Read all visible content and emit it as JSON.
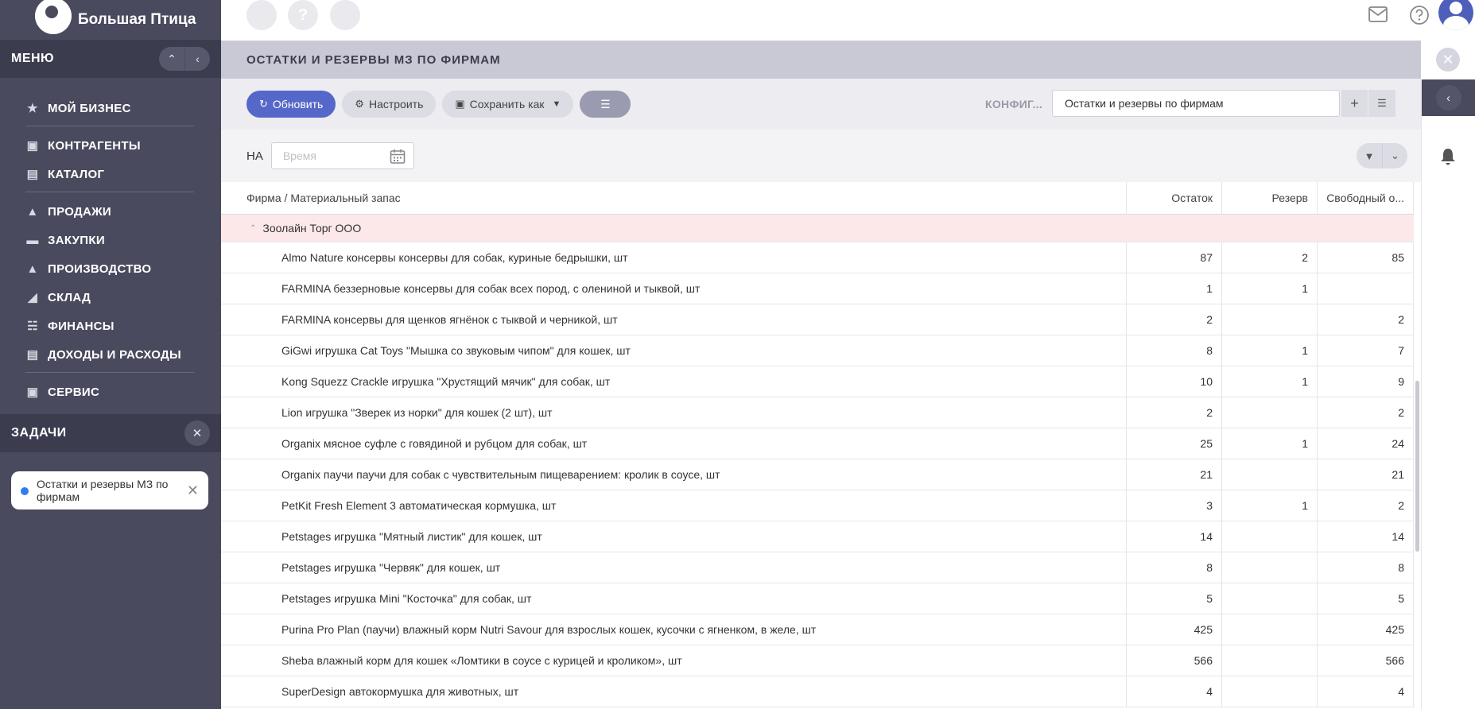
{
  "app": {
    "logo_text": "Большая Птица"
  },
  "sidebar": {
    "menu_title": "МЕНЮ",
    "groups": [
      [
        {
          "label": "МОЙ БИЗНЕС",
          "icon": "star-icon"
        }
      ],
      [
        {
          "label": "КОНТРАГЕНТЫ",
          "icon": "briefcase-icon"
        },
        {
          "label": "КАТАЛОГ",
          "icon": "book-icon"
        }
      ],
      [
        {
          "label": "ПРОДАЖИ",
          "icon": "basket-icon"
        },
        {
          "label": "ЗАКУПКИ",
          "icon": "truck-icon"
        },
        {
          "label": "ПРОИЗВОДСТВО",
          "icon": "factory-icon"
        },
        {
          "label": "СКЛАД",
          "icon": "warehouse-icon"
        },
        {
          "label": "ФИНАНСЫ",
          "icon": "bank-icon"
        },
        {
          "label": "ДОХОДЫ И РАСХОДЫ",
          "icon": "wallet-icon"
        }
      ],
      [
        {
          "label": "СЕРВИС",
          "icon": "service-icon"
        }
      ]
    ],
    "tasks_title": "ЗАДАЧИ",
    "task_card": "Остатки и резервы МЗ по фирмам"
  },
  "main": {
    "title": "ОСТАТКИ И РЕЗЕРВЫ МЗ ПО ФИРМАМ",
    "toolbar": {
      "refresh": "Обновить",
      "configure": "Настроить",
      "save_as": "Сохранить как",
      "config_label": "КОНФИГ...",
      "config_value": "Остатки и резервы по фирмам"
    },
    "filter": {
      "on_label": "НА",
      "date_placeholder": "Время"
    },
    "table": {
      "columns": [
        "Фирма / Материальный запас",
        "Остаток",
        "Резерв",
        "Свободный о..."
      ],
      "group": "Зоолайн Торг ООО",
      "rows": [
        [
          "Almo Nature консервы консервы для собак, куриные бедрышки, шт",
          "87",
          "2",
          "85"
        ],
        [
          "FARMINA беззерновые консервы для собак всех пород, с олениной и тыквой, шт",
          "1",
          "1",
          ""
        ],
        [
          "FARMINA консервы для щенков ягнёнок с тыквой и черникой, шт",
          "2",
          "",
          "2"
        ],
        [
          "GiGwi игрушка Cat Toys \"Мышка со звуковым чипом\" для кошек, шт",
          "8",
          "1",
          "7"
        ],
        [
          "Kong Squezz Crackle игрушка \"Хрустящий мячик\" для собак, шт",
          "10",
          "1",
          "9"
        ],
        [
          "Lion игрушка \"Зверек из норки\" для кошек (2 шт), шт",
          "2",
          "",
          "2"
        ],
        [
          "Organix мясное суфле с говядиной и рубцом для собак, шт",
          "25",
          "1",
          "24"
        ],
        [
          "Organix паучи паучи для собак с чувствительным пищеварением: кролик в соусе, шт",
          "21",
          "",
          "21"
        ],
        [
          "PetKit Fresh Element 3 автоматическая кормушка, шт",
          "3",
          "1",
          "2"
        ],
        [
          "Petstages игрушка \"Мятный листик\" для кошек, шт",
          "14",
          "",
          "14"
        ],
        [
          "Petstages игрушка \"Червяк\" для кошек, шт",
          "8",
          "",
          "8"
        ],
        [
          "Petstages игрушка Mini \"Косточка\" для собак, шт",
          "5",
          "",
          "5"
        ],
        [
          "Purina Pro Plan (паучи) влажный корм Nutri Savour для взрослых кошек, кусочки с ягненком, в желе, шт",
          "425",
          "",
          "425"
        ],
        [
          "Sheba влажный корм для кошек «Ломтики в соусе с курицей и кроликом», шт",
          "566",
          "",
          "566"
        ],
        [
          "SuperDesign автокормушка для животных, шт",
          "4",
          "",
          "4"
        ]
      ]
    }
  },
  "colors": {
    "accent": "#5567c9",
    "sidebar": "#4a4a5e",
    "group_row": "#fde8e9"
  }
}
